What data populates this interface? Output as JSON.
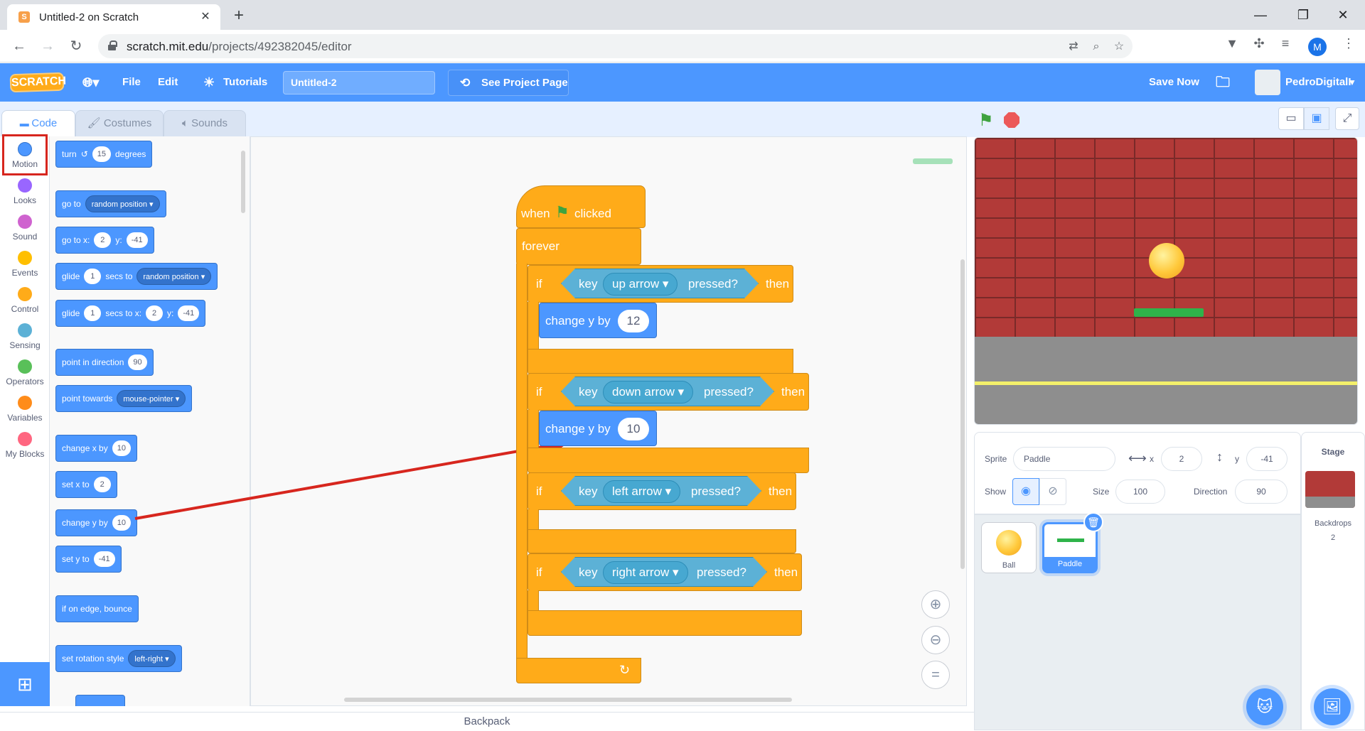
{
  "browser": {
    "tab_title": "Untitled-2 on Scratch",
    "url_host": "scratch.mit.edu",
    "url_path": "/projects/492382045/editor",
    "profile_initial": "M"
  },
  "menubar": {
    "logo": "SCRATCH",
    "file": "File",
    "edit": "Edit",
    "tutorials": "Tutorials",
    "project_title": "Untitled-2",
    "see_project": "See Project Page",
    "save_now": "Save Now",
    "username": "PedroDigitalI"
  },
  "tabs": {
    "code": "Code",
    "costumes": "Costumes",
    "sounds": "Sounds"
  },
  "categories": [
    {
      "label": "Motion",
      "color": "#4c97ff"
    },
    {
      "label": "Looks",
      "color": "#9966ff"
    },
    {
      "label": "Sound",
      "color": "#cf63cf"
    },
    {
      "label": "Events",
      "color": "#ffbf00"
    },
    {
      "label": "Control",
      "color": "#ffab19"
    },
    {
      "label": "Sensing",
      "color": "#5cb1d6"
    },
    {
      "label": "Operators",
      "color": "#59c059"
    },
    {
      "label": "Variables",
      "color": "#ff8c1a"
    },
    {
      "label": "My Blocks",
      "color": "#ff6680"
    }
  ],
  "palette": {
    "turn": "turn",
    "turn_val": "15",
    "degrees": "degrees",
    "goto": "go to",
    "random_position": "random position",
    "goto_xy": "go to x:",
    "x_val": "2",
    "y_lbl": "y:",
    "y_val": "-41",
    "glide": "glide",
    "glide_secs": "1",
    "secs_to": "secs to",
    "glide_random": "random position",
    "glide2": "glide",
    "glide2_secs": "1",
    "secs_to_x": "secs to x:",
    "glide2_x": "2",
    "glide2_y_lbl": "y:",
    "glide2_y": "-41",
    "point_dir": "point in direction",
    "dir_val": "90",
    "point_towards": "point towards",
    "mouse_pointer": "mouse-pointer",
    "change_x": "change x by",
    "change_x_val": "10",
    "set_x": "set x to",
    "set_x_val": "2",
    "change_y": "change y by",
    "change_y_val": "10",
    "set_y": "set y to",
    "set_y_val": "-41",
    "bounce": "if on edge, bounce",
    "rotation": "set rotation style",
    "left_right": "left-right"
  },
  "script": {
    "when": "when",
    "clicked": "clicked",
    "forever": "forever",
    "if1": "if",
    "key1": "key",
    "up_arrow": "up arrow",
    "pressed1": "pressed?",
    "then1": "then",
    "change1": "change y by",
    "change1_val": "12",
    "if2": "if",
    "key2": "key",
    "down_arrow": "down arrow",
    "pressed2": "pressed?",
    "then2": "then",
    "change2": "change y by",
    "change2_val": "10",
    "if3": "if",
    "key3": "key",
    "left_arrow": "left arrow",
    "pressed3": "pressed?",
    "then3": "then",
    "if4": "if",
    "key4": "key",
    "right_arrow": "right arrow",
    "pressed4": "pressed?",
    "then4": "then"
  },
  "backpack": "Backpack",
  "sprite_info": {
    "sprite_lbl": "Sprite",
    "sprite_name": "Paddle",
    "x_lbl": "x",
    "x_val": "2",
    "y_lbl": "y",
    "y_val": "-41",
    "show_lbl": "Show",
    "size_lbl": "Size",
    "size_val": "100",
    "direction_lbl": "Direction",
    "direction_val": "90"
  },
  "sprites": [
    {
      "name": "Ball"
    },
    {
      "name": "Paddle"
    }
  ],
  "stage_panel": {
    "title": "Stage",
    "backdrops_lbl": "Backdrops",
    "backdrops_count": "2"
  }
}
